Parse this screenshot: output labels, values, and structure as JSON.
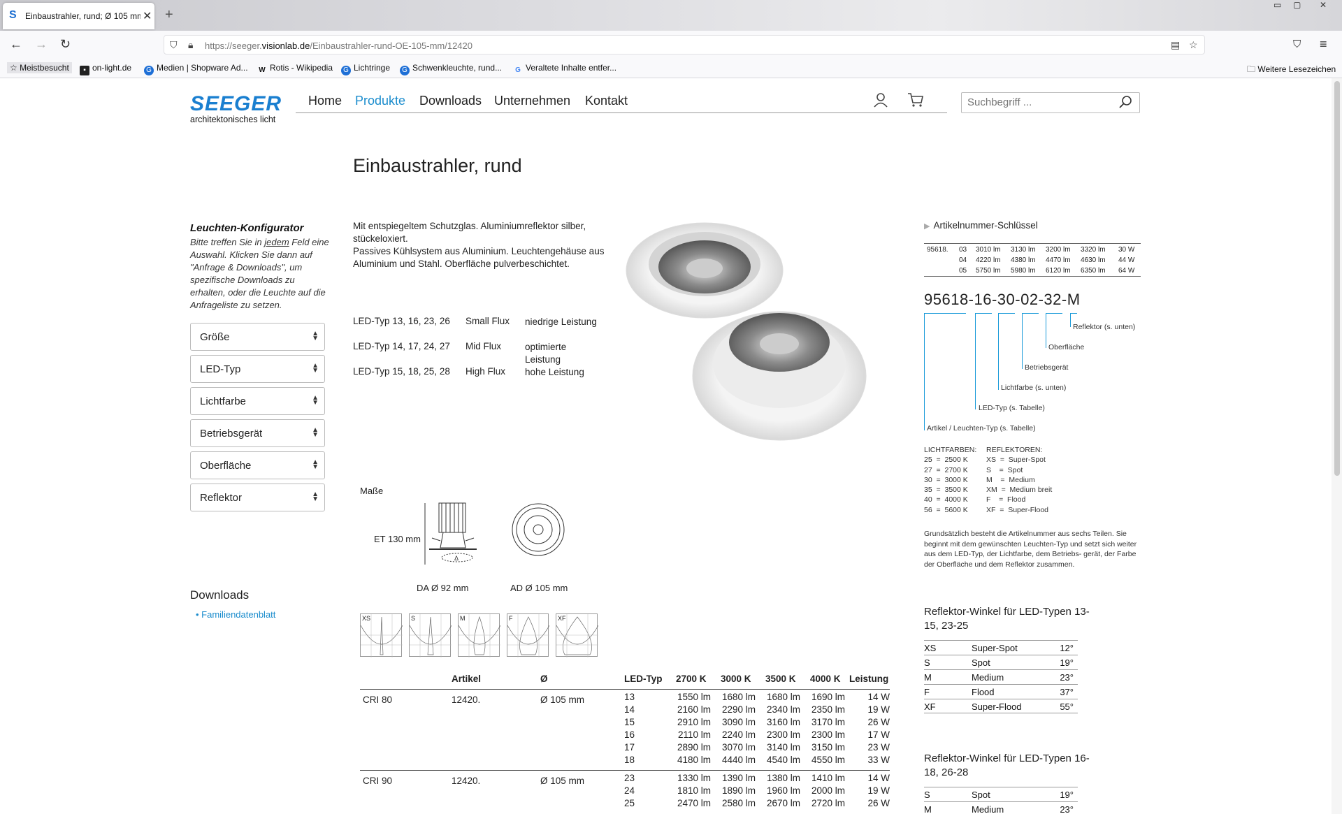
{
  "browser": {
    "tab_title": "Einbaustrahler, rund; Ø 105 mm",
    "tab_favicon": "S",
    "url_prefix": "https://seeger.",
    "url_domain": "visionlab.de",
    "url_path": "/Einbaustrahler-rund-OE-105-mm/12420",
    "bookmarks": [
      "Meistbesucht",
      "on-light.de",
      "Medien | Shopware Ad...",
      "Rotis - Wikipedia",
      "Lichtringe",
      "Schwenkleuchte, rund...",
      "Veraltete Inhalte entfer...",
      "Weitere Lesezeichen"
    ]
  },
  "header": {
    "brand": "SEEGER",
    "tagline": "architektonisches licht",
    "nav": [
      "Home",
      "Produkte",
      "Downloads",
      "Unternehmen",
      "Kontakt"
    ],
    "search_placeholder": "Suchbegriff ..."
  },
  "page_title": "Einbaustrahler, rund",
  "configurator": {
    "title": "Leuchten-Konfigurator",
    "text_1": "Bitte treffen Sie in ",
    "text_em": "jedem",
    "text_2": " Feld eine Auswahl. Klicken Sie dann auf \"Anfrage & Downloads\", um spezifische Downloads zu erhalten, oder die Leuchte auf die Anfrageliste zu setzen.",
    "selects": [
      "Größe",
      "LED-Typ",
      "Lichtfarbe",
      "Betriebsgerät",
      "Oberfläche",
      "Reflektor"
    ]
  },
  "downloads": {
    "title": "Downloads",
    "items": [
      "Familiendatenblatt"
    ]
  },
  "description": {
    "line1": "Mit entspiegeltem Schutzglas. Aluminiumreflektor silber, stückeloxiert.",
    "line2": "Passives Kühlsystem aus Aluminium. Leuchtengehäuse aus Aluminium und Stahl. Oberfläche pulverbeschichtet."
  },
  "led_types": [
    {
      "types": "LED-Typ 13, 16, 23, 26",
      "flux": "Small Flux",
      "power": "niedrige Leistung"
    },
    {
      "types": "LED-Typ 14, 17, 24, 27",
      "flux": "Mid Flux",
      "power": "optimierte Leistung"
    },
    {
      "types": "LED-Typ 15, 18, 25, 28",
      "flux": "High Flux",
      "power": "hohe Leistung"
    }
  ],
  "masse": {
    "title": "Maße",
    "et": "ET 130 mm",
    "da": "DA Ø 92 mm",
    "ad": "AD Ø 105 mm"
  },
  "reflector_icons": [
    "XS",
    "S",
    "M",
    "F",
    "XF"
  ],
  "table": {
    "headers": [
      "Artikel",
      "Ø",
      "LED-Typ",
      "2700 K",
      "3000 K",
      "3500 K",
      "4000 K",
      "Leistung"
    ],
    "groups": [
      {
        "cri": "CRI 80",
        "artikel": "12420.",
        "diameter": "Ø 105 mm",
        "rows": [
          [
            "13",
            "1550 lm",
            "1680 lm",
            "1680 lm",
            "1690 lm",
            "14 W"
          ],
          [
            "14",
            "2160 lm",
            "2290 lm",
            "2340 lm",
            "2350 lm",
            "19 W"
          ],
          [
            "15",
            "2910 lm",
            "3090 lm",
            "3160 lm",
            "3170 lm",
            "26 W"
          ],
          [
            "16",
            "2110 lm",
            "2240 lm",
            "2300 lm",
            "2300 lm",
            "17 W"
          ],
          [
            "17",
            "2890 lm",
            "3070 lm",
            "3140 lm",
            "3150 lm",
            "23 W"
          ],
          [
            "18",
            "4180 lm",
            "4440 lm",
            "4540 lm",
            "4550 lm",
            "33 W"
          ]
        ]
      },
      {
        "cri": "CRI 90",
        "artikel": "12420.",
        "diameter": "Ø 105 mm",
        "rows": [
          [
            "23",
            "1330 lm",
            "1390 lm",
            "1380 lm",
            "1410 lm",
            "14 W"
          ],
          [
            "24",
            "1810 lm",
            "1890 lm",
            "1960 lm",
            "2000 lm",
            "19 W"
          ],
          [
            "25",
            "2470 lm",
            "2580 lm",
            "2670 lm",
            "2720 lm",
            "26 W"
          ]
        ]
      }
    ]
  },
  "artikel_key": {
    "title": "Artikelnummer-Schlüssel",
    "rows": [
      [
        "95618.",
        "03",
        "3010 lm",
        "3130 lm",
        "3200 lm",
        "3320 lm",
        "30 W"
      ],
      [
        "",
        "04",
        "4220 lm",
        "4380 lm",
        "4470 lm",
        "4630 lm",
        "44 W"
      ],
      [
        "",
        "05",
        "5750 lm",
        "5980 lm",
        "6120 lm",
        "6350 lm",
        "64 W"
      ]
    ],
    "number": "95618-16-30-02-32-M",
    "labels": [
      "Reflektor (s. unten)",
      "Oberfläche",
      "Betriebsgerät",
      "Lichtfarbe (s. unten)",
      "LED-Typ (s. Tabelle)",
      "Artikel / Leuchten-Typ (s. Tabelle)"
    ],
    "lichtfarben_title": "LICHTFARBEN:",
    "lichtfarben": [
      "25  =  2500 K",
      "27  =  2700 K",
      "30  =  3000 K",
      "35  =  3500 K",
      "40  =  4000 K",
      "56  =  5600 K"
    ],
    "reflektoren_title": "REFLEKTOREN:",
    "reflektoren": [
      "XS  =  Super-Spot",
      "S    =  Spot",
      "M    =  Medium",
      "XM  =  Medium breit",
      "F    =  Flood",
      "XF  =  Super-Flood"
    ],
    "note": "Grundsätzlich besteht die Artikelnummer aus sechs Teilen. Sie beginnt mit dem gewünschten Leuchten-Typ und setzt sich weiter aus dem LED-Typ, der Lichtfarbe, dem Betriebs- gerät, der Farbe der Oberfläche und dem Reflektor zusammen."
  },
  "winkel_1": {
    "title": "Reflektor-Winkel für LED-Typen 13-15, 23-25",
    "rows": [
      [
        "XS",
        "Super-Spot",
        "12°"
      ],
      [
        "S",
        "Spot",
        "19°"
      ],
      [
        "M",
        "Medium",
        "23°"
      ],
      [
        "F",
        "Flood",
        "37°"
      ],
      [
        "XF",
        "Super-Flood",
        "55°"
      ]
    ]
  },
  "winkel_2": {
    "title": "Reflektor-Winkel für LED-Typen 16-18, 26-28",
    "rows": [
      [
        "S",
        "Spot",
        "19°"
      ],
      [
        "M",
        "Medium",
        "23°"
      ]
    ]
  },
  "colors": {
    "accent": "#1a8ccd",
    "brand": "#1a7fd0",
    "key_lines": "#1a9bd9"
  }
}
